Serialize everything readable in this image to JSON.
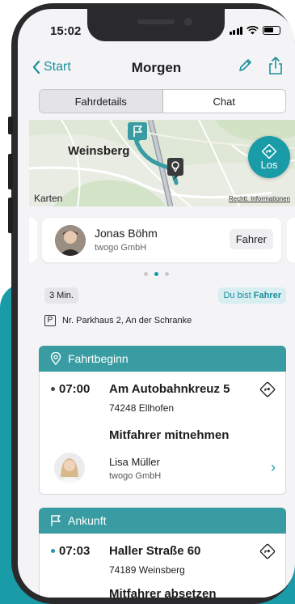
{
  "status_bar": {
    "time": "15:02"
  },
  "nav": {
    "back_label": "Start",
    "title": "Morgen",
    "edit_icon": "pencil-icon",
    "share_icon": "share-icon"
  },
  "tabs": [
    {
      "label": "Fahrdetails",
      "active": true
    },
    {
      "label": "Chat",
      "active": false
    }
  ],
  "map": {
    "place_label": "Weinsberg",
    "go_button_label": "Los",
    "attribution": "Karten",
    "legal_label": "Rechtl. Informationen"
  },
  "driver": {
    "name": "Jonas Böhm",
    "company": "twogo GmbH",
    "role": "Fahrer"
  },
  "pager": {
    "count": 3,
    "active_index": 1
  },
  "trip": {
    "duration": "3 Min.",
    "role_prefix": "Du bist",
    "role_value": "Fahrer",
    "parking": "Nr. Parkhaus 2, An der Schranke"
  },
  "departure": {
    "header": "Fahrtbeginn",
    "time": "07:00",
    "street": "Am Autobahnkreuz 5",
    "city": "74248 Ellhofen",
    "action": "Mitfahrer mitnehmen",
    "passenger": {
      "name": "Lisa Müller",
      "company": "twogo GmbH"
    }
  },
  "arrival": {
    "header": "Ankunft",
    "time": "07:03",
    "street": "Haller Straße 60",
    "city": "74189 Weinsberg",
    "action": "Mitfahrer absetzen"
  },
  "colors": {
    "accent": "#1a9ba8",
    "section_header": "#3a9ca3",
    "background_teal": "#1a9ba8"
  }
}
